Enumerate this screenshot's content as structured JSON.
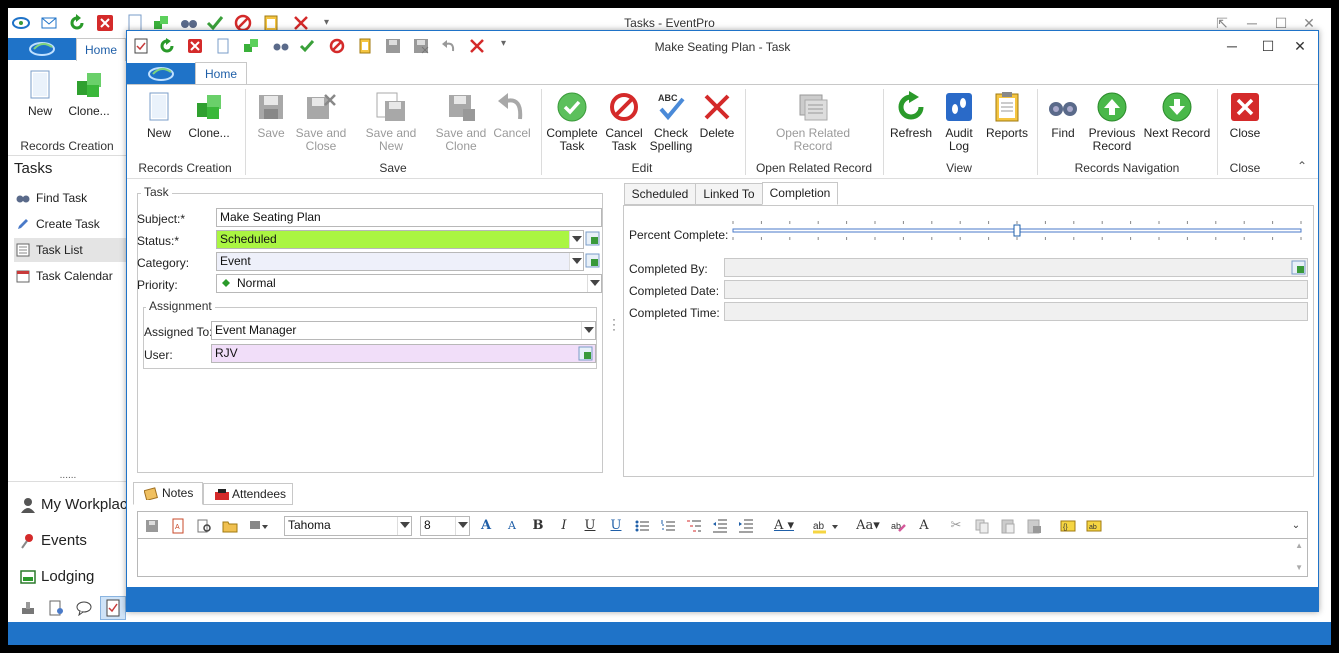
{
  "background_window": {
    "title": "Tasks - EventPro",
    "home_tab": "Home",
    "ribbon": {
      "new_label": "New",
      "clone_label": "Clone...",
      "group_label": "Records Creation"
    },
    "sidebar": {
      "title": "Tasks",
      "items": [
        {
          "label": "Find Task",
          "icon": "binoculars-icon"
        },
        {
          "label": "Create Task",
          "icon": "pencil-icon"
        },
        {
          "label": "Task List",
          "icon": "list-icon"
        },
        {
          "label": "Task Calendar",
          "icon": "calendar-icon"
        }
      ],
      "splitter": "......",
      "nav": [
        {
          "label": "My Workplace",
          "icon": "user-icon"
        },
        {
          "label": "Events",
          "icon": "pin-icon"
        },
        {
          "label": "Lodging",
          "icon": "lodging-icon"
        }
      ]
    }
  },
  "dialog": {
    "title": "Make Seating Plan - Task",
    "home_tab": "Home",
    "ribbon": {
      "records_creation": {
        "label": "Records Creation",
        "new": "New",
        "clone": "Clone..."
      },
      "save": {
        "label": "Save",
        "save": "Save",
        "save_close": "Save and Close",
        "save_new": "Save and New",
        "save_clone": "Save and Clone",
        "cancel": "Cancel"
      },
      "edit": {
        "label": "Edit",
        "complete": "Complete Task",
        "cancel_task": "Cancel Task",
        "check_spelling": "Check Spelling",
        "delete": "Delete"
      },
      "open_related": {
        "label": "Open Related Record",
        "open": "Open Related Record"
      },
      "view": {
        "label": "View",
        "refresh": "Refresh",
        "audit": "Audit Log",
        "reports": "Reports"
      },
      "nav": {
        "label": "Records Navigation",
        "find": "Find",
        "previous": "Previous Record",
        "next": "Next Record"
      },
      "close": {
        "label": "Close",
        "close": "Close"
      }
    },
    "task": {
      "legend": "Task",
      "subject_label": "Subject:*",
      "subject_value": "Make Seating Plan",
      "status_label": "Status:*",
      "status_value": "Scheduled",
      "status_color": "#aaf542",
      "category_label": "Category:",
      "category_value": "Event",
      "priority_label": "Priority:",
      "priority_value": "Normal",
      "assignment_legend": "Assignment",
      "assigned_label": "Assigned To:",
      "assigned_value": "Event Manager",
      "user_label": "User:",
      "user_value": "RJV",
      "user_color": "#f1def9"
    },
    "tabs": [
      "Scheduled",
      "Linked To",
      "Completion"
    ],
    "active_tab": "Completion",
    "completion": {
      "percent_label": "Percent Complete:",
      "percent_value": 0.5,
      "completed_by_label": "Completed By:",
      "completed_date_label": "Completed Date:",
      "completed_time_label": "Completed Time:"
    },
    "bottom_tabs": [
      "Notes",
      "Attendees"
    ],
    "editor": {
      "font": "Tahoma",
      "size": "8"
    }
  }
}
